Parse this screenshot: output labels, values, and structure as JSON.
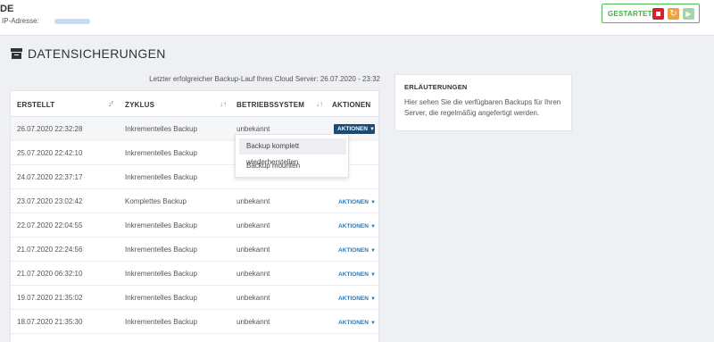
{
  "header": {
    "server_name": "DE",
    "ip_label": "IP-Adresse:",
    "status": "GESTARTET",
    "controls": [
      {
        "name": "stop-icon",
        "color": "#d9212d"
      },
      {
        "name": "restart-icon",
        "color": "#f0a042"
      },
      {
        "name": "play-icon",
        "color": "#9fd7a7"
      }
    ]
  },
  "page": {
    "title": "DATENSICHERUNGEN",
    "last_backup": "Letzter erfolgreicher Backup-Lauf Ihres Cloud Server: 26.07.2020 - 23:32"
  },
  "table": {
    "headers": [
      "ERSTELLT",
      "ZYKLUS",
      "BETRIEBSSYSTEM",
      "AKTIONEN"
    ],
    "action_label": "AKTIONEN",
    "rows": [
      {
        "date": "26.07.2020 22:32:28",
        "cycle": "Inkrementelles Backup",
        "os": "unbekannt"
      },
      {
        "date": "25.07.2020 22:42:10",
        "cycle": "Inkrementelles Backup",
        "os": ""
      },
      {
        "date": "24.07.2020 22:37:17",
        "cycle": "Inkrementelles Backup",
        "os": ""
      },
      {
        "date": "23.07.2020 23:02:42",
        "cycle": "Komplettes Backup",
        "os": "unbekannt"
      },
      {
        "date": "22.07.2020 22:04:55",
        "cycle": "Inkrementelles Backup",
        "os": "unbekannt"
      },
      {
        "date": "21.07.2020 22:24:56",
        "cycle": "Inkrementelles Backup",
        "os": "unbekannt"
      },
      {
        "date": "21.07.2020 06:32:10",
        "cycle": "Inkrementelles Backup",
        "os": "unbekannt"
      },
      {
        "date": "19.07.2020 21:35:02",
        "cycle": "Inkrementelles Backup",
        "os": "unbekannt"
      },
      {
        "date": "18.07.2020 21:35:30",
        "cycle": "Inkrementelles Backup",
        "os": "unbekannt"
      }
    ]
  },
  "dropdown": {
    "items": [
      "Backup komplett wiederherstellen",
      "Backup mounten"
    ]
  },
  "explanation": {
    "title": "ERLÄUTERUNGEN",
    "text": "Hier sehen Sie die verfügbaren Backups für Ihren Server, die regelmäßig angefertigt werden."
  },
  "colors": {
    "accent": "#1a4a76",
    "link": "#2d77b1",
    "status": "#4cba52"
  }
}
